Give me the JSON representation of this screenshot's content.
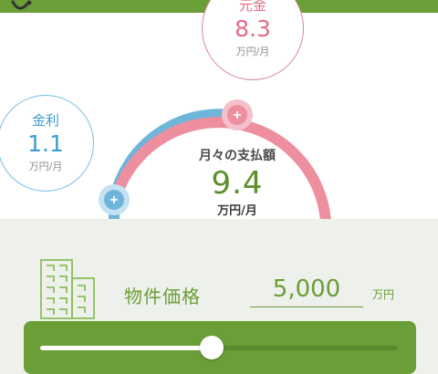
{
  "principal": {
    "label": "元金",
    "value": "8.3",
    "unit": "万円/月"
  },
  "interest": {
    "label": "金利",
    "value": "1.1",
    "unit": "万円/月"
  },
  "payment": {
    "label": "月々の支払額",
    "value": "9.4",
    "unit": "万円/月"
  },
  "property_price": {
    "label": "物件価格",
    "value": "5,000",
    "unit": "万円"
  },
  "slider": {
    "fraction": 0.48
  },
  "colors": {
    "brand_green": "#6a9e36",
    "principal_pink": "#e06c86",
    "interest_blue": "#3d9bd0",
    "arc_pink": "#ee8fa0",
    "panel_bg": "#eef0ec"
  }
}
